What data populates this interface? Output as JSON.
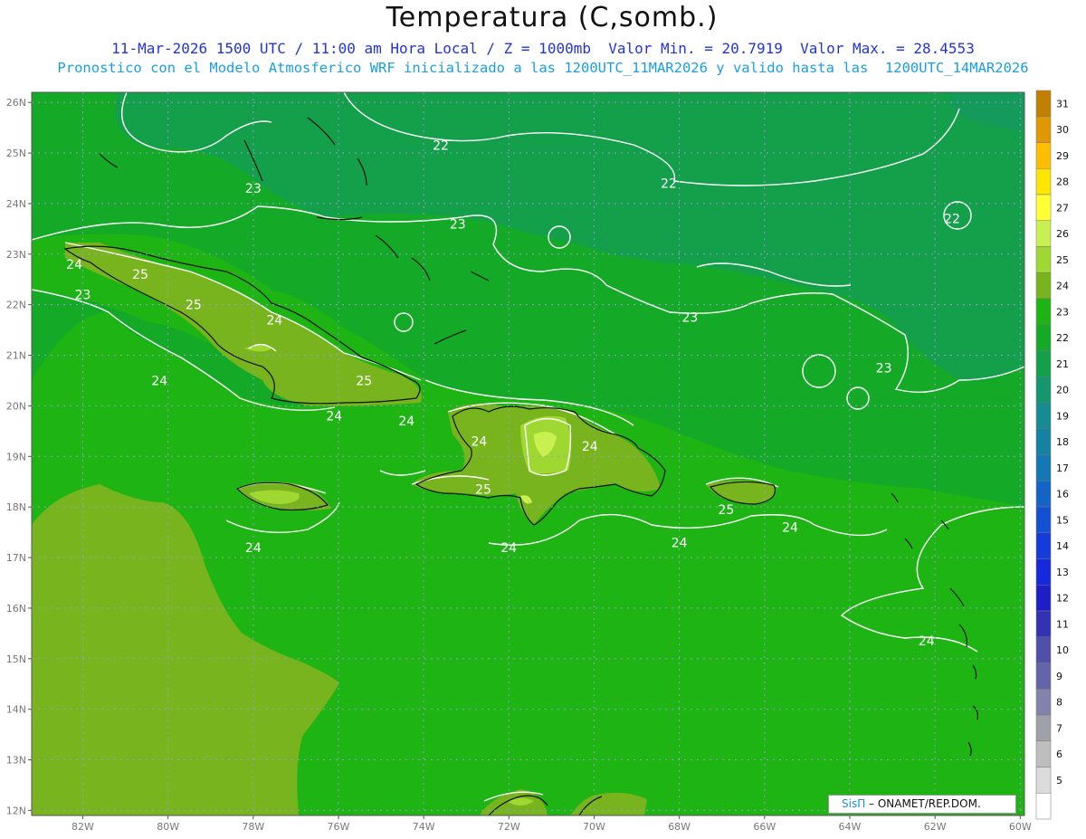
{
  "title": "Temperatura (C,somb.)",
  "subtitle1": "11-Mar-2026 1500 UTC / 11:00 am Hora Local / Z = 1000mb  Valor Min. = 20.7919  Valor Max. = 28.4553",
  "subtitle2": "Pronostico con el Modelo Atmosferico WRF inicializado a las 1200UTC_11MAR2026 y valido hasta las  1200UTC_14MAR2026",
  "credit": {
    "brand": "SisΠ",
    "text": " – ONAMET/REP.DOM."
  },
  "axes": {
    "lat_ticks": [
      "26N",
      "25N",
      "24N",
      "23N",
      "22N",
      "21N",
      "20N",
      "19N",
      "18N",
      "17N",
      "16N",
      "15N",
      "14N",
      "13N",
      "12N"
    ],
    "lon_ticks": [
      "82W",
      "80W",
      "78W",
      "76W",
      "74W",
      "72W",
      "70W",
      "68W",
      "66W",
      "64W",
      "62W",
      "60W"
    ]
  },
  "colorbar": {
    "labels": [
      "31",
      "30",
      "29",
      "28",
      "27",
      "26",
      "25",
      "24",
      "23",
      "22",
      "21",
      "20",
      "19",
      "18",
      "17",
      "16",
      "15",
      "14",
      "13",
      "12",
      "11",
      "10",
      "9",
      "8",
      "7",
      "6",
      "5"
    ],
    "colors": [
      "#c08000",
      "#e09800",
      "#ffbf00",
      "#ffe600",
      "#ffff33",
      "#c8f050",
      "#a0d832",
      "#78b41e",
      "#1eb414",
      "#14aa28",
      "#14a04b",
      "#14966e",
      "#148c91",
      "#1482a0",
      "#1478b4",
      "#1464c8",
      "#1450d2",
      "#143cdc",
      "#1428dc",
      "#1e1ec8",
      "#3232b4",
      "#5050aa",
      "#6464aa",
      "#8282aa",
      "#a0a0aa",
      "#bebebe",
      "#dcdcdc",
      "#ffffff"
    ]
  },
  "contours": [
    {
      "label": "22",
      "lon": -73.6,
      "lat": 25.15
    },
    {
      "label": "22",
      "lon": -68.25,
      "lat": 24.4
    },
    {
      "label": "22",
      "lon": -61.6,
      "lat": 23.7
    },
    {
      "label": "23",
      "lon": -78.0,
      "lat": 24.3
    },
    {
      "label": "23",
      "lon": -73.2,
      "lat": 23.6
    },
    {
      "label": "23",
      "lon": -67.75,
      "lat": 21.75
    },
    {
      "label": "23",
      "lon": -63.2,
      "lat": 20.75
    },
    {
      "label": "23",
      "lon": -82.0,
      "lat": 22.2
    },
    {
      "label": "24",
      "lon": -82.2,
      "lat": 22.8
    },
    {
      "label": "24",
      "lon": -77.5,
      "lat": 21.7
    },
    {
      "label": "24",
      "lon": -80.2,
      "lat": 20.5
    },
    {
      "label": "24",
      "lon": -76.1,
      "lat": 19.8
    },
    {
      "label": "24",
      "lon": -74.4,
      "lat": 19.7
    },
    {
      "label": "24",
      "lon": -72.7,
      "lat": 19.3
    },
    {
      "label": "24",
      "lon": -70.1,
      "lat": 19.2
    },
    {
      "label": "24",
      "lon": -78.0,
      "lat": 17.2
    },
    {
      "label": "24",
      "lon": -72.0,
      "lat": 17.2
    },
    {
      "label": "24",
      "lon": -68.0,
      "lat": 17.3
    },
    {
      "label": "24",
      "lon": -65.4,
      "lat": 17.6
    },
    {
      "label": "24",
      "lon": -62.2,
      "lat": 15.35
    },
    {
      "label": "25",
      "lon": -80.65,
      "lat": 22.6
    },
    {
      "label": "25",
      "lon": -79.4,
      "lat": 22.0
    },
    {
      "label": "25",
      "lon": -75.4,
      "lat": 20.5
    },
    {
      "label": "25",
      "lon": -72.6,
      "lat": 18.35
    },
    {
      "label": "25",
      "lon": -66.9,
      "lat": 17.95
    }
  ]
}
